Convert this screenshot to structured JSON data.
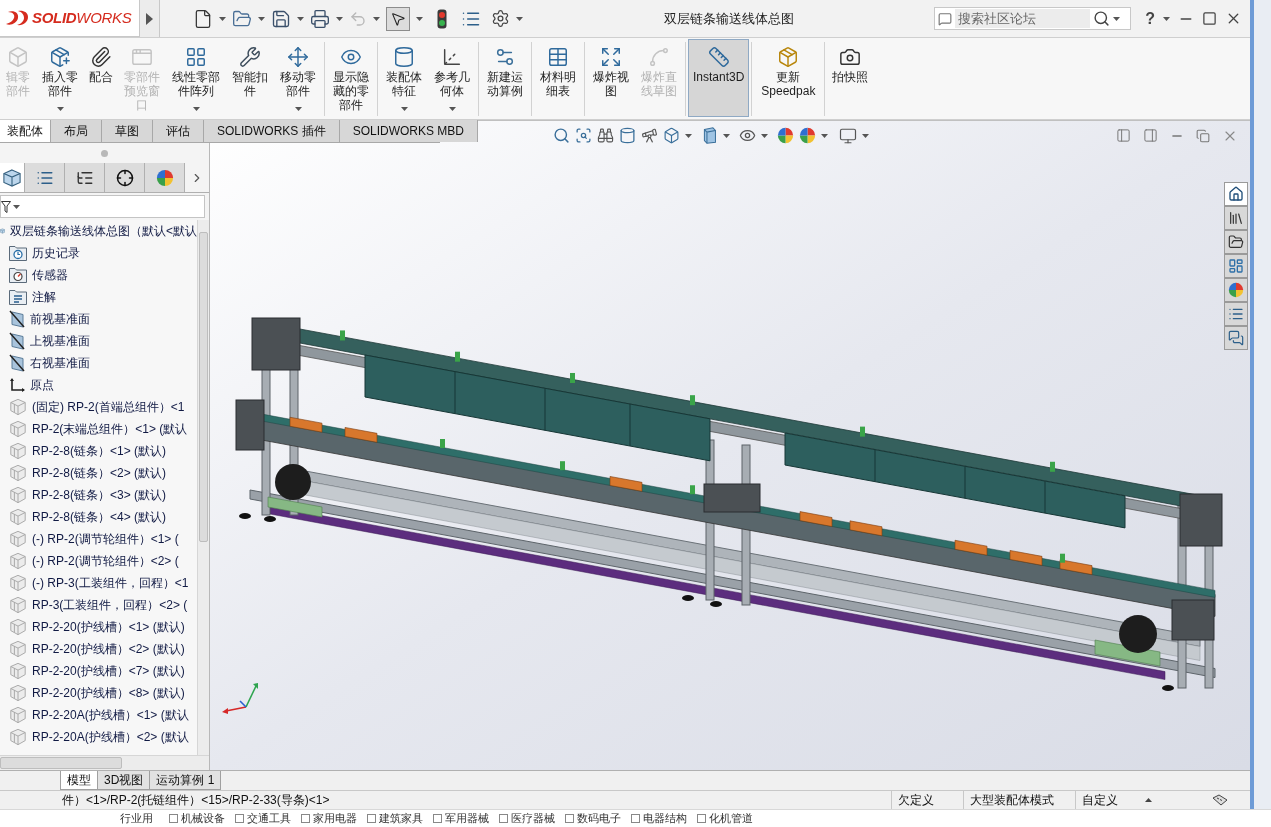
{
  "title_bar": {
    "logo": "**SOLID**WORKS",
    "quick_access": {
      "undo_disabled": true,
      "select_selected": true
    },
    "title": "双层链条输送线体总图",
    "search": {
      "placeholder": "搜索社区论坛"
    },
    "help": "?"
  },
  "ribbon": {
    "groups": [
      [
        {
          "label": "辑零部件",
          "disabled": true,
          "dropdown": false,
          "selected": false
        },
        {
          "label": "插入零部件",
          "disabled": false,
          "dropdown": true,
          "selected": false
        },
        {
          "label": "配合",
          "disabled": false,
          "dropdown": false,
          "selected": false
        },
        {
          "label": "零部件预览窗口",
          "disabled": true,
          "dropdown": false,
          "selected": false
        },
        {
          "label": "线性零部件阵列",
          "disabled": false,
          "dropdown": true,
          "selected": false
        },
        {
          "label": "智能扣件",
          "disabled": false,
          "dropdown": false,
          "selected": false
        },
        {
          "label": "移动零部件",
          "disabled": false,
          "dropdown": true,
          "selected": false
        }
      ],
      [
        {
          "label": "显示隐藏的零部件",
          "disabled": false,
          "dropdown": false,
          "selected": false
        }
      ],
      [
        {
          "label": "装配体特征",
          "disabled": false,
          "dropdown": true,
          "selected": false
        },
        {
          "label": "参考几何体",
          "disabled": false,
          "dropdown": true,
          "selected": false
        }
      ],
      [
        {
          "label": "新建运动算例",
          "disabled": false,
          "dropdown": false,
          "selected": false
        }
      ],
      [
        {
          "label": "材料明细表",
          "disabled": false,
          "dropdown": false,
          "selected": false
        }
      ],
      [
        {
          "label": "爆炸视图",
          "disabled": false,
          "dropdown": false,
          "selected": false
        },
        {
          "label": "爆炸直线草图",
          "disabled": true,
          "dropdown": false,
          "selected": false
        }
      ],
      [
        {
          "label": "Instant3D",
          "disabled": false,
          "dropdown": false,
          "selected": true
        }
      ],
      [
        {
          "label": "更新Speedpak",
          "disabled": false,
          "dropdown": false,
          "selected": false
        }
      ],
      [
        {
          "label": "拍快照",
          "disabled": false,
          "dropdown": false,
          "selected": false
        }
      ]
    ]
  },
  "command_tabs": [
    {
      "label": "装配体",
      "selected": true
    },
    {
      "label": "布局",
      "selected": false
    },
    {
      "label": "草图",
      "selected": false
    },
    {
      "label": "评估",
      "selected": false
    },
    {
      "label": "SOLIDWORKS 插件",
      "selected": false
    },
    {
      "label": "SOLIDWORKS MBD",
      "selected": false
    }
  ],
  "feature_manager": {
    "tabs": [
      {
        "selected": true
      },
      {
        "selected": false
      },
      {
        "selected": false
      },
      {
        "selected": false
      },
      {
        "selected": false
      }
    ],
    "tree": {
      "label": "双层链条输送线体总图（默认<默认",
      "kind": "assembly",
      "children": [
        {
          "label": "历史记录",
          "kind": "history"
        },
        {
          "label": "传感器",
          "kind": "sensor"
        },
        {
          "label": "注解",
          "kind": "annotation"
        },
        {
          "label": "前视基准面",
          "kind": "plane"
        },
        {
          "label": "上视基准面",
          "kind": "plane"
        },
        {
          "label": "右视基准面",
          "kind": "plane"
        },
        {
          "label": "原点",
          "kind": "origin"
        },
        {
          "label": "(固定) RP-2(首端总组件）<1",
          "kind": "component"
        },
        {
          "label": "RP-2(末端总组件）<1> (默认",
          "kind": "component"
        },
        {
          "label": "RP-2-8(链条）<1> (默认)",
          "kind": "component"
        },
        {
          "label": "RP-2-8(链条）<2> (默认)",
          "kind": "component"
        },
        {
          "label": "RP-2-8(链条）<3> (默认)",
          "kind": "component"
        },
        {
          "label": "RP-2-8(链条）<4> (默认)",
          "kind": "component"
        },
        {
          "label": "(-) RP-2(调节轮组件）<1> (",
          "kind": "component"
        },
        {
          "label": "(-) RP-2(调节轮组件）<2> (",
          "kind": "component"
        },
        {
          "label": "(-) RP-3(工装组件，回程）<1",
          "kind": "component"
        },
        {
          "label": "RP-3(工装组件，回程）<2> (",
          "kind": "component"
        },
        {
          "label": "RP-2-20(护线槽）<1> (默认)",
          "kind": "component"
        },
        {
          "label": "RP-2-20(护线槽）<2> (默认)",
          "kind": "component"
        },
        {
          "label": "RP-2-20(护线槽）<7> (默认)",
          "kind": "component"
        },
        {
          "label": "RP-2-20(护线槽）<8> (默认)",
          "kind": "component"
        },
        {
          "label": "RP-2-20A(护线槽）<1> (默认",
          "kind": "component"
        },
        {
          "label": "RP-2-20A(护线槽）<2> (默认",
          "kind": "component"
        }
      ]
    }
  },
  "task_pane": [
    {
      "selected": true
    },
    {
      "selected": false
    },
    {
      "selected": false
    },
    {
      "selected": false
    },
    {
      "selected": false
    },
    {
      "selected": false
    },
    {
      "selected": false
    }
  ],
  "bottom_tabs": [
    {
      "label": "模型",
      "selected": true
    },
    {
      "label": "3D视图",
      "selected": false
    },
    {
      "label": "运动算例 1",
      "selected": false
    }
  ],
  "status_bar": {
    "path": "件）<1>/RP-2(托链组件）<15>/RP-2-33(导条)<1>",
    "fields": [
      "欠定义",
      "大型装配体模式",
      "自定义"
    ]
  },
  "background_page": {
    "label": "行业用",
    "categories": [
      {
        "label": "机械设备",
        "checked": false
      },
      {
        "label": "交通工具",
        "checked": false
      },
      {
        "label": "家用电器",
        "checked": false
      },
      {
        "label": "建筑家具",
        "checked": false
      },
      {
        "label": "军用器械",
        "checked": false
      },
      {
        "label": "医疗器械",
        "checked": false
      },
      {
        "label": "数码电子",
        "checked": false
      },
      {
        "label": "电器结构",
        "checked": false
      },
      {
        "label": "化机管道",
        "checked": false
      }
    ]
  }
}
